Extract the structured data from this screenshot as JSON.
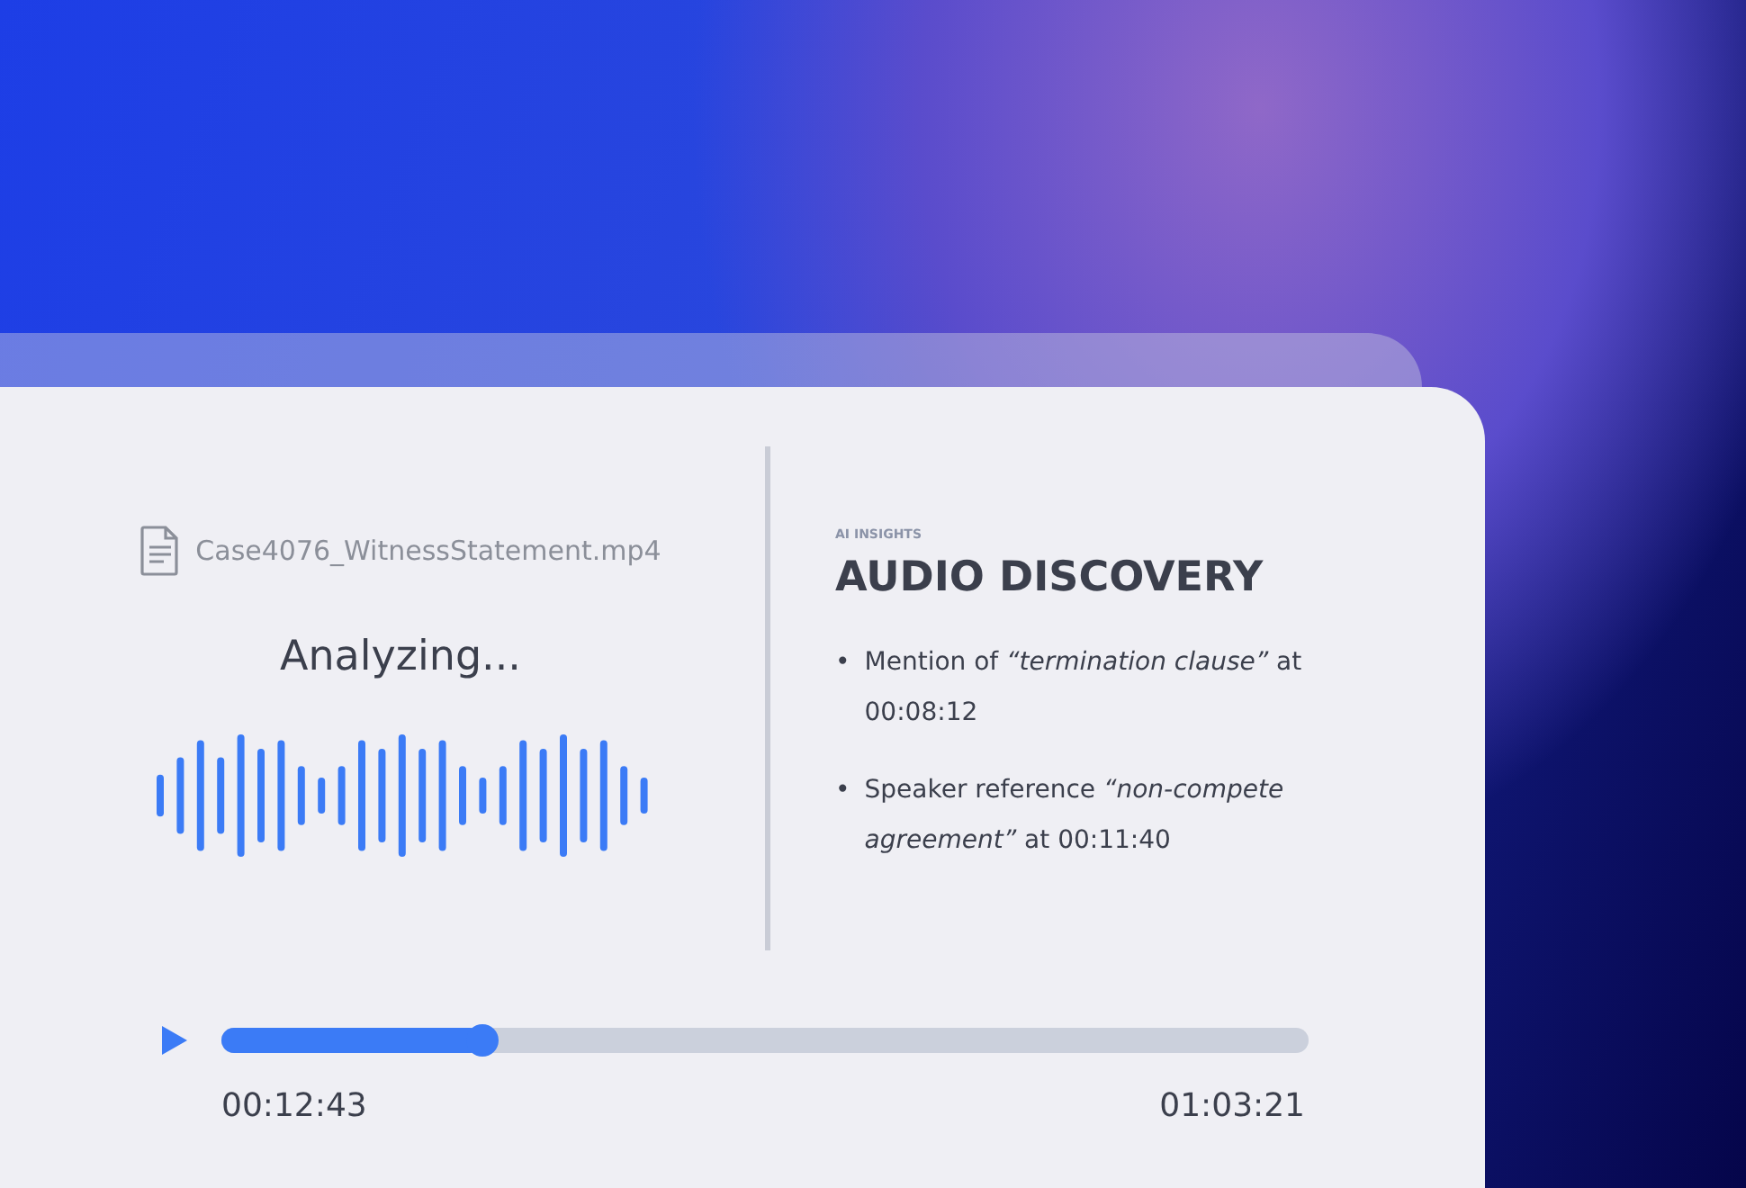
{
  "file": {
    "name": "Case4076_WitnessStatement.mp4"
  },
  "status": "Analyzing...",
  "insights": {
    "eyebrow": "AI INSIGHTS",
    "title": "AUDIO DISCOVERY",
    "items": [
      {
        "bullet": "•",
        "text": "Mention of *“termination clause”* at 00:08:12"
      },
      {
        "bullet": "•",
        "text": "Speaker reference *“non-compete agreement”* at 00:11:40"
      }
    ]
  },
  "player": {
    "level": 0.24,
    "elapsed": "00:12:43",
    "total": "01:03:21"
  }
}
